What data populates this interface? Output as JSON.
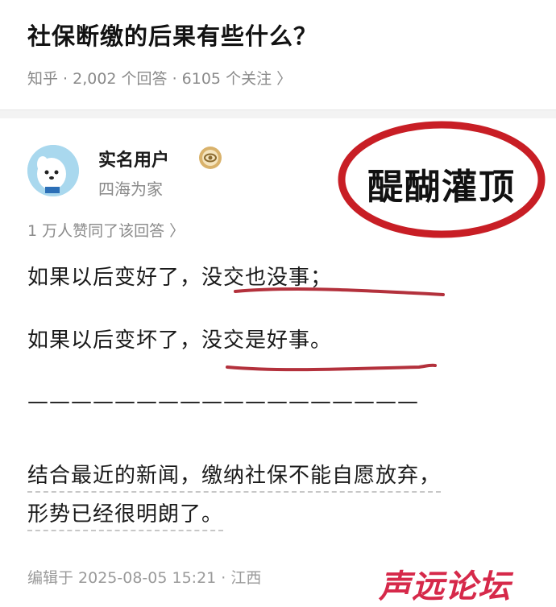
{
  "question": {
    "title": "社保断缴的后果有些什么？",
    "meta": "知乎 · 2,002 个回答 · 6105 个关注 〉"
  },
  "author": {
    "name": "实名用户",
    "bio": "四海为家"
  },
  "stamp": {
    "text": "醍醐灌顶",
    "color": "#c81e25"
  },
  "answer": {
    "upvote_summary": "1 万人赞同了该回答 〉",
    "line1_plain": "如果以后变好了，",
    "line1_highlight": "没交也没事；",
    "line2_plain": "如果以后变坏了，",
    "line2_highlight": "没交是好事。",
    "separator": "——————————————————",
    "line3": "结合最近的新闻，缴纳社保不能自愿放弃，",
    "line4": "形势已经很明朗了。"
  },
  "edit_info": "编辑于 2025-08-05 15:21 · 江西",
  "watermark": "声远论坛"
}
